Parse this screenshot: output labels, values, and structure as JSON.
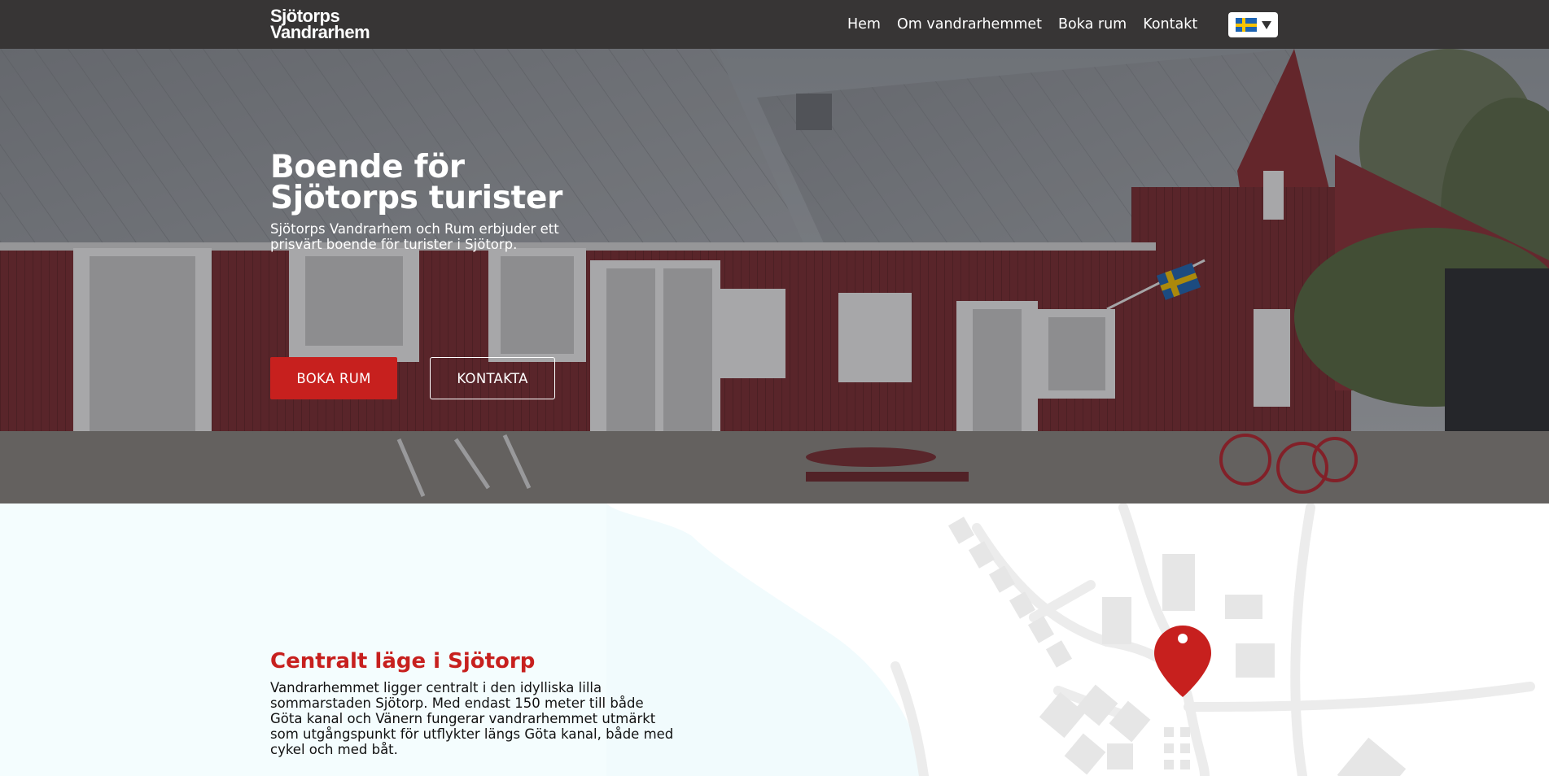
{
  "nav": {
    "logo_line1": "Sjötorps",
    "logo_line2": "Vandrarhem",
    "items": [
      {
        "label": "Hem"
      },
      {
        "label": "Om vandrarhemmet"
      },
      {
        "label": "Boka rum"
      },
      {
        "label": "Kontakt"
      }
    ],
    "language": {
      "selected": "sv",
      "icon": "swedish-flag-icon"
    }
  },
  "hero": {
    "title": "Boende för Sjötorps turister",
    "subtitle": "Sjötorps Vandrarhem och Rum erbjuder ett prisvärt boende för turister i Sjötorp.",
    "primary_button": "BOKA RUM",
    "secondary_button": "KONTAKTA"
  },
  "location": {
    "title": "Centralt läge i Sjötorp",
    "text": "Vandrarhemmet ligger centralt i den idylliska lilla sommarstaden Sjötorp. Med endast 150 meter till både Göta kanal och Vänern fungerar vandrarhemmet utmärkt som utgångspunkt för utflykter längs Göta kanal, både med cykel och med båt."
  },
  "colors": {
    "nav_bg": "#373535",
    "accent_red": "#c7201e",
    "page_bg": "#f4fdfe"
  }
}
